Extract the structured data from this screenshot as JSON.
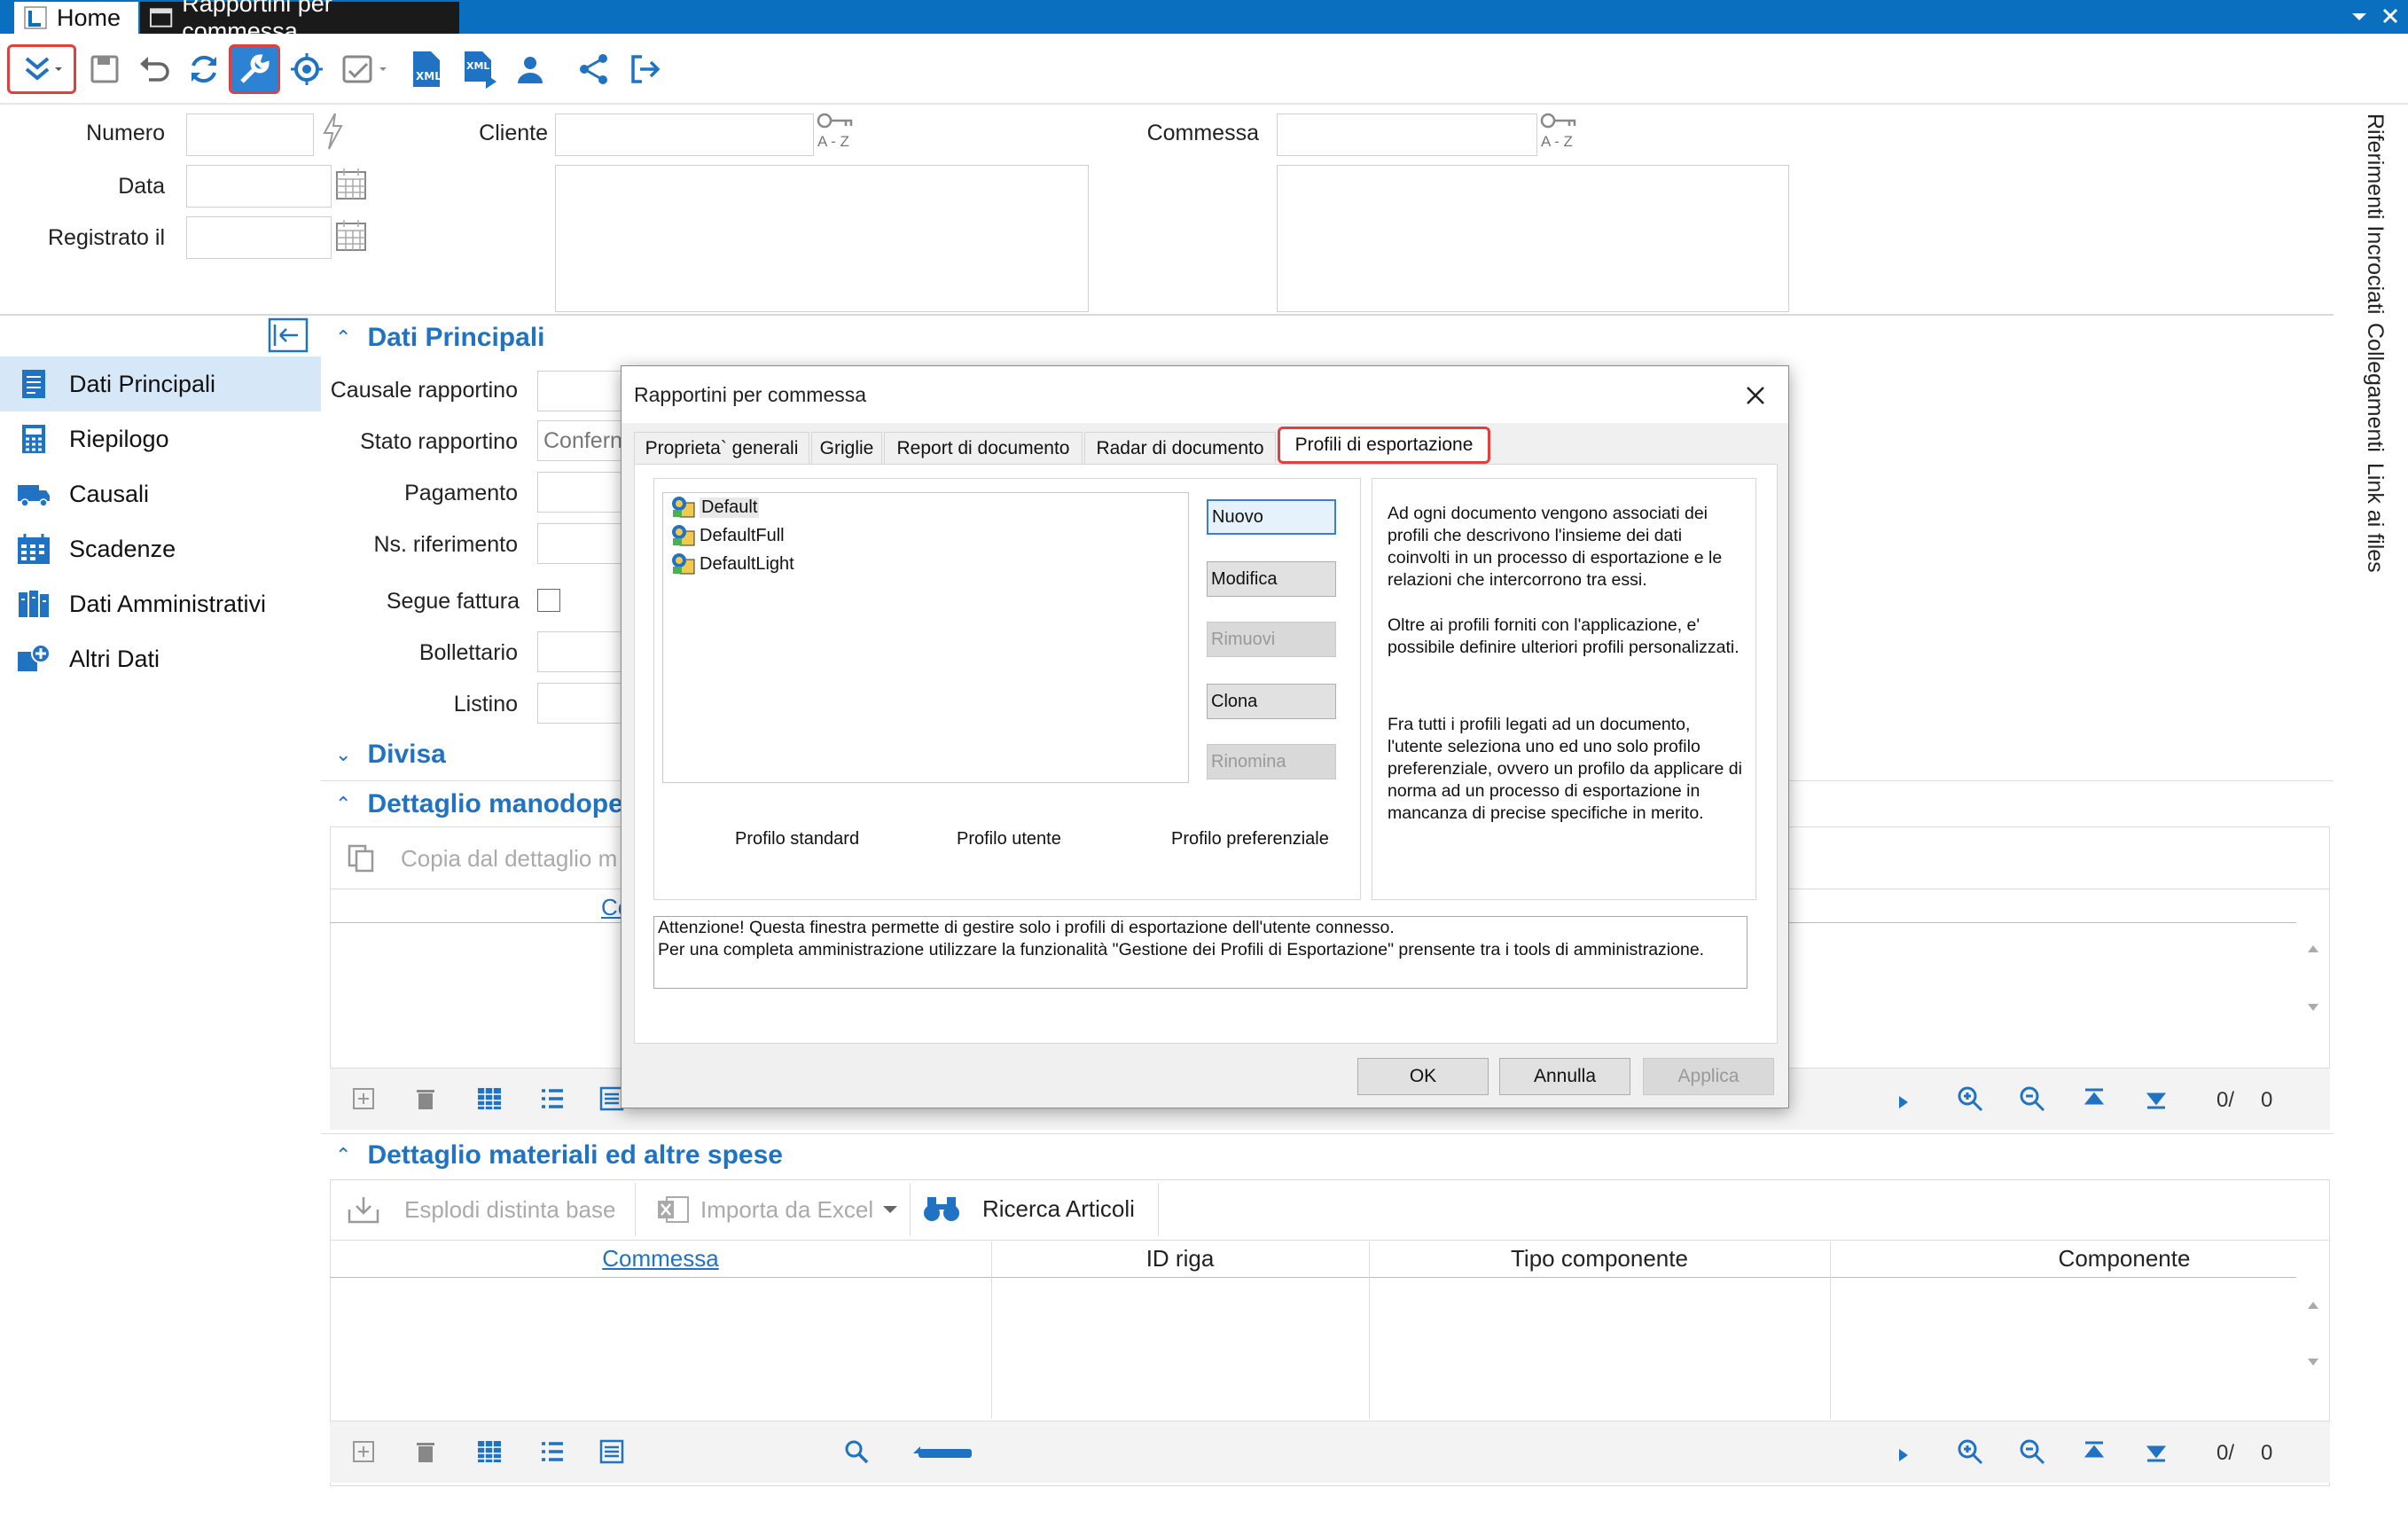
{
  "titlebar": {
    "home_tab": "Home",
    "doc_tab": "Rapportini per commessa"
  },
  "header": {
    "numero_label": "Numero",
    "data_label": "Data",
    "registrato_label": "Registrato il",
    "cliente_label": "Cliente",
    "commessa_label": "Commessa",
    "az_label": "A - Z"
  },
  "nav": {
    "items": [
      {
        "label": "Dati Principali"
      },
      {
        "label": "Riepilogo"
      },
      {
        "label": "Causali"
      },
      {
        "label": "Scadenze"
      },
      {
        "label": "Dati Amministrativi"
      },
      {
        "label": "Altri Dati"
      }
    ]
  },
  "main": {
    "sec_dati_principali": "Dati Principali",
    "causale_label": "Causale rapportino",
    "stato_label": "Stato rapportino",
    "stato_value": "Confern",
    "pagamento_label": "Pagamento",
    "nsrif_label": "Ns. riferimento",
    "segue_label": "Segue fattura",
    "bollettario_label": "Bollettario",
    "listino_label": "Listino",
    "sec_divisa": "Divisa",
    "sec_manodopera": "Dettaglio manodopera",
    "copia_label": "Copia dal dettaglio m",
    "col_partial": "Cc",
    "counter1_a": "0/",
    "counter1_b": "0",
    "sec_materiali": "Dettaglio materiali ed altre spese",
    "esplodi_label": "Esplodi distinta base",
    "importa_label": "Importa da Excel",
    "ricerca_label": "Ricerca Articoli",
    "col_commessa": "Commessa",
    "col_idriga": "ID riga",
    "col_tipo": "Tipo componente",
    "col_componente": "Componente",
    "counter2_a": "0/",
    "counter2_b": "0"
  },
  "rightstrip": {
    "riferimenti": "Riferimenti Incrociati",
    "collegamenti": "Collegamenti",
    "link": "Link ai files"
  },
  "dialog": {
    "title": "Rapportini per commessa",
    "tabs": [
      "Proprieta` generali",
      "Griglie",
      "Report di documento",
      "Radar di documento",
      "Profili di esportazione"
    ],
    "profiles": [
      "Default",
      "DefaultFull",
      "DefaultLight"
    ],
    "buttons": {
      "nuovo": "Nuovo",
      "modifica": "Modifica",
      "rimuovi": "Rimuovi",
      "clona": "Clona",
      "rinomina": "Rinomina"
    },
    "legend": {
      "standard": "Profilo standard",
      "utente": "Profilo utente",
      "preferenziale": "Profilo preferenziale"
    },
    "info_p1": "Ad ogni documento vengono associati dei profili che descrivono l'insieme dei dati coinvolti in un processo di esportazione e le relazioni che intercorrono tra essi.",
    "info_p2": "Oltre ai profili forniti con l'applicazione, e' possibile definire ulteriori profili personalizzati.",
    "info_p3": "Fra tutti i profili legati ad un documento, l'utente seleziona uno ed uno solo profilo preferenziale, ovvero un profilo da applicare di norma ad un processo di esportazione in mancanza di precise specifiche in merito.",
    "warning": "Attenzione! Questa finestra permette di gestire solo i profili di esportazione dell'utente connesso.\nPer una completa amministrazione utilizzare la funzionalità \"Gestione dei Profili di Esportazione\" prensente tra i tools di amministrazione.",
    "ok": "OK",
    "annulla": "Annulla",
    "applica": "Applica"
  },
  "colors": {
    "accent": "#0b6fc0",
    "section": "#1f73c2",
    "highlight": "#e04040"
  }
}
